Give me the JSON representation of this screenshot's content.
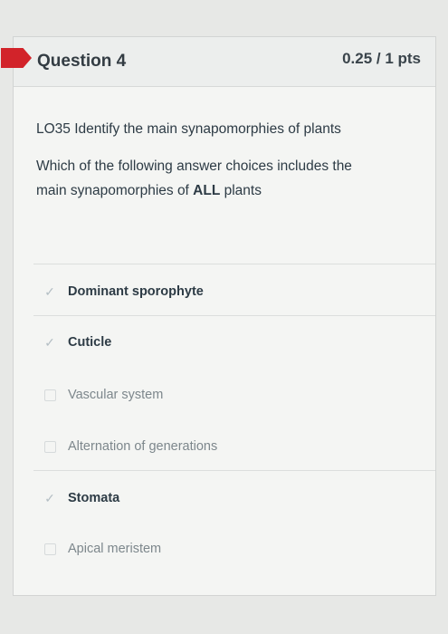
{
  "question": {
    "title": "Question 4",
    "points": "0.25 / 1 pts"
  },
  "prompt": {
    "objective": "LO35 Identify the main synapomorphies of plants",
    "line1": "Which of the following answer choices includes the",
    "line2_prefix": "main synapomorphies of ",
    "line2_bold": "ALL",
    "line2_suffix": " plants"
  },
  "options": [
    {
      "label": "Dominant sporophyte",
      "checked": true
    },
    {
      "label": "Cuticle",
      "checked": true
    },
    {
      "label": "Vascular system",
      "checked": false
    },
    {
      "label": "Alternation of generations",
      "checked": false
    },
    {
      "label": "Stomata",
      "checked": true
    },
    {
      "label": "Apical meristem",
      "checked": false
    }
  ],
  "icons": {
    "flag": "flag-icon",
    "checked": "checkmark-icon",
    "unchecked": "checkbox-icon"
  },
  "colors": {
    "flag": "#d2232a",
    "text": "#2d3b45",
    "muted": "#7d878c"
  }
}
